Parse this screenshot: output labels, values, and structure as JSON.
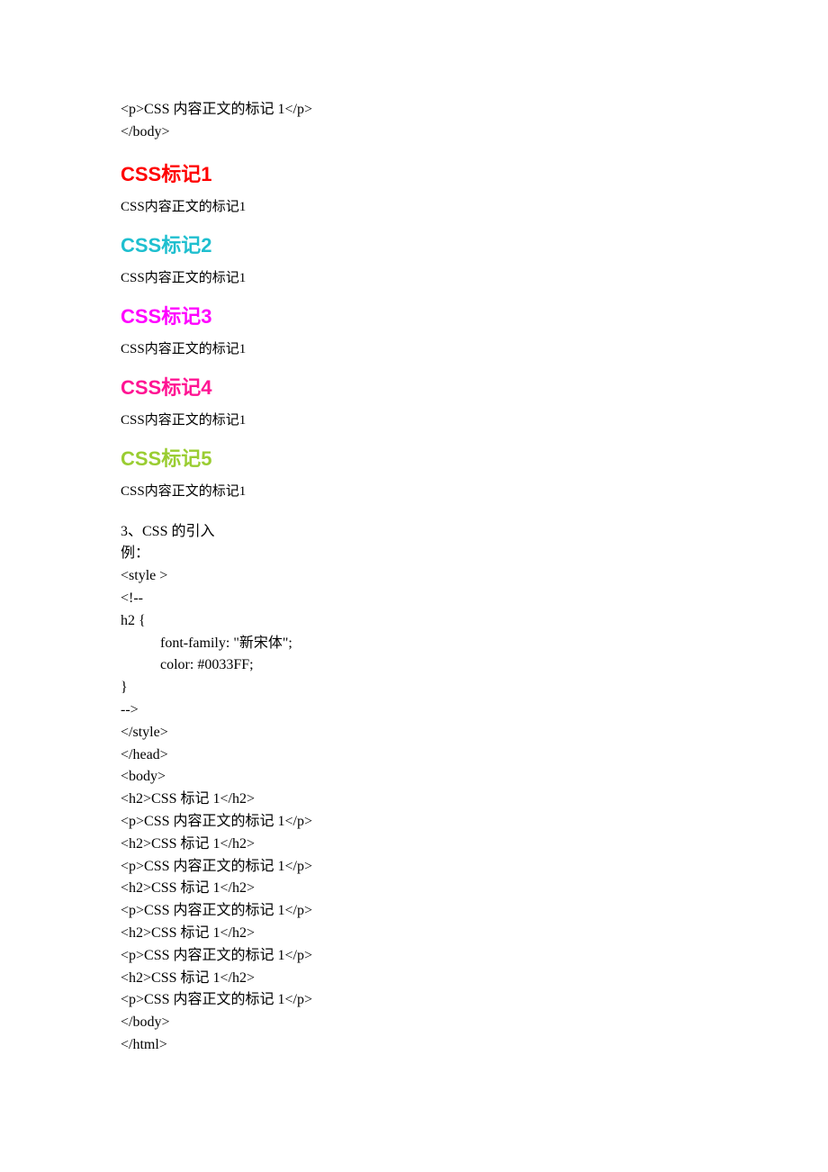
{
  "header": {
    "code1": "<p>CSS 内容正文的标记 1</p>",
    "code2": "</body>"
  },
  "demo": {
    "items": [
      {
        "heading": "CSS标记1",
        "text": "CSS内容正文的标记1"
      },
      {
        "heading": "CSS标记2",
        "text": "CSS内容正文的标记1"
      },
      {
        "heading": "CSS标记3",
        "text": "CSS内容正文的标记1"
      },
      {
        "heading": "CSS标记4",
        "text": "CSS内容正文的标记1"
      },
      {
        "heading": "CSS标记5",
        "text": "CSS内容正文的标记1"
      }
    ]
  },
  "section": {
    "title": "3、CSS 的引入",
    "example_label": "例：",
    "lines": {
      "l1": "<style >",
      "l2": "<!--",
      "l3": "h2 {",
      "l4": "font-family: \"新宋体\";",
      "l5": "color: #0033FF;",
      "l6": "}",
      "l7": "-->",
      "l8": "</style>",
      "l9": "</head>",
      "l10": "<body>",
      "l11": "<h2>CSS 标记 1</h2>",
      "l12": "<p>CSS 内容正文的标记 1</p>",
      "l13": "<h2>CSS 标记 1</h2>",
      "l14": "<p>CSS 内容正文的标记 1</p>",
      "l15": "<h2>CSS 标记 1</h2>",
      "l16": "<p>CSS 内容正文的标记 1</p>",
      "l17": "<h2>CSS 标记 1</h2>",
      "l18": "<p>CSS 内容正文的标记 1</p>",
      "l19": "<h2>CSS 标记 1</h2>",
      "l20": "<p>CSS 内容正文的标记 1</p>",
      "l21": "</body>",
      "l22": "</html>"
    }
  }
}
